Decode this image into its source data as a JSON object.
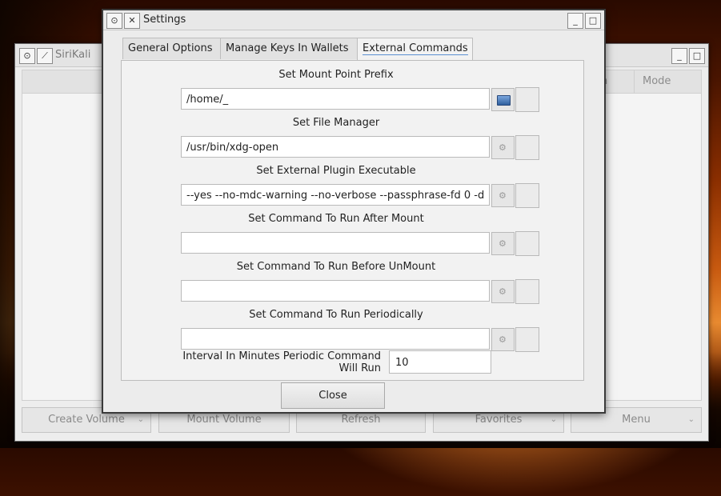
{
  "background_window": {
    "title": "SiriKali",
    "columns": [
      "n",
      "Mode"
    ],
    "buttons": [
      "Create Volume",
      "Mount Volume",
      "Refresh",
      "Favorites",
      "Menu"
    ]
  },
  "dialog": {
    "title": "Settings",
    "tabs": [
      "General Options",
      "Manage Keys In Wallets",
      "External Commands"
    ],
    "active_tab": "External Commands",
    "rows": [
      {
        "label": "Set Mount Point Prefix",
        "value": "/home/_",
        "icon": "folder-icon"
      },
      {
        "label": "Set File Manager",
        "value": "/usr/bin/xdg-open",
        "icon": "gear-icon"
      },
      {
        "label": "Set External Plugin Executable",
        "value": "--yes --no-mdc-warning --no-verbose --passphrase-fd 0 -d",
        "icon": "gear-icon"
      },
      {
        "label": "Set Command To Run After Mount",
        "value": "",
        "icon": "gear-icon"
      },
      {
        "label": "Set Command To Run Before UnMount",
        "value": "",
        "icon": "gear-icon"
      },
      {
        "label": "Set Command To Run Periodically",
        "value": "",
        "icon": "gear-icon"
      }
    ],
    "interval_label_line1": "Interval In Minutes Periodic Command",
    "interval_label_line2": "Will Run",
    "interval_value": "10",
    "close_label": "Close"
  }
}
